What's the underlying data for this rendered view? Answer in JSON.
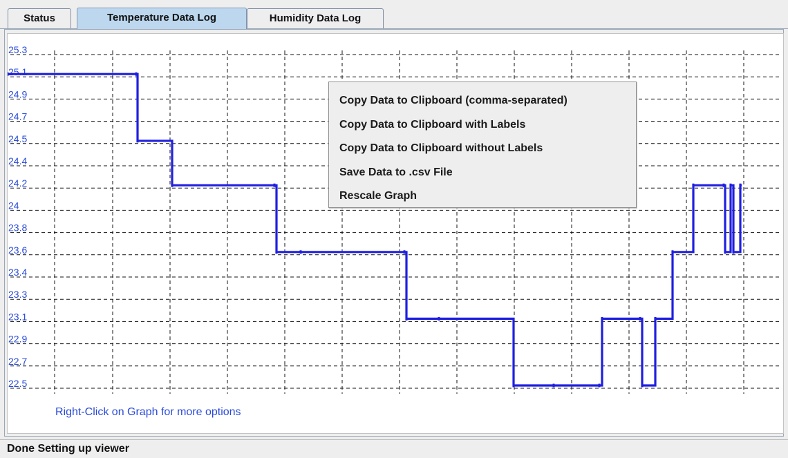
{
  "tabs": {
    "status": "Status",
    "temperature": "Temperature Data Log",
    "humidity": "Humidity Data Log",
    "active": "Temperature Data Log"
  },
  "graph": {
    "hint": "Right-Click on Graph for more options",
    "colors": {
      "line": "#1f1fe0",
      "labels": "#2a4bd9",
      "grid": "#111111"
    }
  },
  "context_menu": {
    "items": [
      "Copy Data to Clipboard (comma-separated)",
      "Copy Data to Clipboard with Labels",
      "Copy Data to Clipboard without Labels",
      "Save Data to .csv File",
      "Rescale Graph"
    ]
  },
  "status_bar": {
    "text": "Done Setting up viewer"
  },
  "chart_data": {
    "type": "line",
    "ytick_labels": [
      "25.3",
      "25.1",
      "24.9",
      "24.7",
      "24.5",
      "24.4",
      "24.2",
      "24",
      "23.8",
      "23.6",
      "23.4",
      "23.3",
      "23.1",
      "22.9",
      "22.7",
      "22.5"
    ],
    "ylim": [
      22.5,
      25.3
    ],
    "grid": true,
    "series": [
      {
        "values": [
          25.1,
          25.1,
          24.5,
          24.2,
          24.2,
          23.6,
          23.6,
          23.6,
          23.1,
          23.1,
          22.5,
          22.5,
          22.5,
          23.1,
          23.1,
          22.5,
          23.1,
          23.6,
          24.2,
          24.2,
          23.6,
          24.2,
          23.6,
          24.2
        ]
      }
    ]
  }
}
